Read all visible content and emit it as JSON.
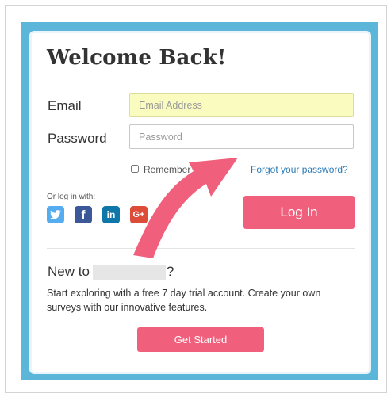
{
  "form": {
    "title": "Welcome Back!",
    "email_label": "Email",
    "email_placeholder": "Email Address",
    "email_value": "",
    "password_label": "Password",
    "password_placeholder": "Password",
    "password_value": "",
    "remember_label": "Remember me",
    "remember_checked": false,
    "forgot_link": "Forgot your password?",
    "social_label": "Or log in with:",
    "social": [
      {
        "icon": "twitter-icon",
        "glyph": ""
      },
      {
        "icon": "facebook-icon",
        "glyph": "f"
      },
      {
        "icon": "linkedin-icon",
        "glyph": "in"
      },
      {
        "icon": "google-plus-icon",
        "glyph": "G+"
      }
    ],
    "login_button": "Log In"
  },
  "signup": {
    "prefix": "New to",
    "suffix": "?",
    "description": "Start exploring with a free 7 day trial account. Create your own surveys with our innovative features.",
    "button": "Get Started"
  },
  "colors": {
    "frame": "#5bb6d9",
    "accent": "#f0607d",
    "link": "#2b7ab5",
    "email_fill": "#f9fbbf"
  }
}
